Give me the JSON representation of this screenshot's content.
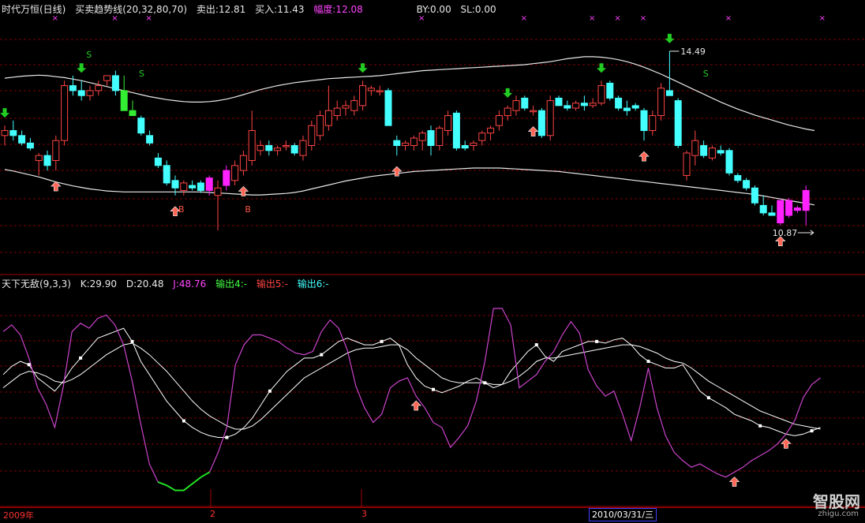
{
  "top_header": {
    "name": "时代万恒(日线)",
    "indicator": "买卖趋势线(20,32,80,70)",
    "sell_label": "卖出:12.81",
    "buy_label": "买入:11.43",
    "range_label": "幅度:12.08",
    "by_label": "BY:0.00",
    "sl_label": "SL:0.00"
  },
  "bottom_header": {
    "name": "天下无敌(9,3,3)",
    "k_label": "K:29.90",
    "d_label": "D:20.48",
    "j_label": "J:48.76",
    "out4": "输出4:-",
    "out5": "输出5:-",
    "out6": "输出6:-"
  },
  "time_axis": {
    "label_2009": "2009年",
    "label_2": "2",
    "label_3": "3",
    "date_box": "2010/03/31/三"
  },
  "watermark": {
    "text": "智股网",
    "sub": "zhigu.com"
  },
  "colors": {
    "up": "#ff4444",
    "down": "#44ffff",
    "highlight": "#ff22ff",
    "signal_buy": "#ff6655",
    "signal_sell": "#22cc22"
  },
  "chart_data": [
    {
      "type": "candlestick",
      "title": "时代万恒(日线)",
      "ylim": [
        10.3,
        15.2
      ],
      "grid": true,
      "price_labels": {
        "high": "14.49",
        "low": "10.87"
      },
      "signal_labels": {
        "S": "S",
        "B": "B"
      },
      "candles": [
        [
          12.8,
          13.0,
          12.6,
          12.9
        ],
        [
          12.9,
          13.1,
          12.7,
          12.8
        ],
        [
          12.8,
          12.9,
          12.6,
          12.65
        ],
        [
          12.65,
          12.75,
          12.5,
          12.55
        ],
        [
          12.3,
          12.45,
          12.0,
          12.4
        ],
        [
          12.4,
          12.5,
          12.1,
          12.2
        ],
        [
          12.3,
          12.8,
          12.1,
          12.7
        ],
        [
          12.7,
          13.9,
          12.6,
          13.8
        ],
        [
          13.8,
          14.0,
          13.6,
          13.7
        ],
        [
          13.7,
          13.9,
          13.5,
          13.6
        ],
        [
          13.6,
          13.8,
          13.5,
          13.7
        ],
        [
          13.7,
          13.9,
          13.6,
          13.8
        ],
        [
          13.9,
          14.0,
          13.8,
          14.0
        ],
        [
          14.0,
          14.1,
          13.6,
          13.7
        ],
        [
          13.7,
          14.0,
          13.6,
          13.3
        ],
        [
          13.3,
          13.5,
          13.2,
          13.2
        ],
        [
          13.15,
          13.2,
          12.8,
          12.85
        ],
        [
          12.8,
          12.9,
          12.6,
          12.65
        ],
        [
          12.35,
          12.45,
          12.15,
          12.2
        ],
        [
          12.2,
          12.3,
          11.8,
          11.85
        ],
        [
          11.9,
          12.0,
          11.6,
          11.75
        ],
        [
          11.7,
          11.9,
          11.6,
          11.85
        ],
        [
          11.8,
          11.9,
          11.7,
          11.75
        ],
        [
          11.85,
          11.9,
          11.65,
          11.7
        ],
        [
          11.7,
          12.0,
          11.6,
          11.95
        ],
        [
          11.6,
          11.9,
          10.9,
          11.75
        ],
        [
          11.8,
          12.2,
          11.7,
          12.1
        ],
        [
          11.9,
          12.3,
          11.8,
          12.2
        ],
        [
          12.1,
          12.5,
          12.0,
          12.4
        ],
        [
          12.3,
          13.3,
          12.2,
          12.9
        ],
        [
          12.5,
          12.7,
          12.4,
          12.6
        ],
        [
          12.6,
          12.7,
          12.4,
          12.5
        ],
        [
          12.5,
          12.6,
          12.4,
          12.55
        ],
        [
          12.6,
          12.7,
          12.5,
          12.6
        ],
        [
          12.6,
          12.65,
          12.4,
          12.45
        ],
        [
          12.4,
          12.8,
          12.3,
          12.7
        ],
        [
          12.6,
          13.1,
          12.5,
          13.0
        ],
        [
          12.8,
          13.3,
          12.7,
          13.2
        ],
        [
          13.0,
          13.8,
          12.9,
          13.3
        ],
        [
          13.2,
          13.5,
          13.1,
          13.35
        ],
        [
          13.35,
          13.5,
          13.2,
          13.4
        ],
        [
          13.3,
          13.6,
          13.2,
          13.5
        ],
        [
          13.4,
          13.9,
          13.3,
          13.8
        ],
        [
          13.7,
          13.8,
          13.6,
          13.75
        ],
        [
          13.7,
          13.8,
          13.6,
          13.7
        ],
        [
          13.7,
          13.75,
          13.0,
          13.0
        ],
        [
          12.7,
          12.8,
          12.4,
          12.6
        ],
        [
          12.6,
          12.7,
          12.5,
          12.65
        ],
        [
          12.6,
          12.8,
          12.5,
          12.75
        ],
        [
          12.7,
          12.9,
          12.5,
          12.85
        ],
        [
          12.9,
          13.0,
          12.4,
          12.6
        ],
        [
          12.6,
          13.0,
          12.5,
          12.95
        ],
        [
          12.9,
          13.3,
          12.8,
          13.2
        ],
        [
          13.25,
          13.3,
          12.5,
          12.55
        ],
        [
          12.6,
          12.7,
          12.5,
          12.55
        ],
        [
          12.6,
          12.7,
          12.5,
          12.65
        ],
        [
          12.7,
          12.9,
          12.6,
          12.85
        ],
        [
          12.85,
          13.0,
          12.7,
          12.95
        ],
        [
          13.0,
          13.3,
          12.9,
          13.2
        ],
        [
          13.2,
          13.4,
          13.1,
          13.35
        ],
        [
          13.3,
          13.6,
          13.2,
          13.5
        ],
        [
          13.55,
          13.6,
          13.3,
          13.35
        ],
        [
          13.3,
          13.4,
          13.2,
          13.3
        ],
        [
          13.3,
          13.35,
          12.75,
          12.8
        ],
        [
          12.8,
          13.6,
          12.7,
          13.5
        ],
        [
          13.55,
          13.6,
          13.4,
          13.4
        ],
        [
          13.4,
          13.5,
          13.3,
          13.35
        ],
        [
          13.35,
          13.5,
          13.3,
          13.45
        ],
        [
          13.45,
          13.6,
          13.3,
          13.4
        ],
        [
          13.4,
          13.55,
          13.35,
          13.45
        ],
        [
          13.45,
          13.9,
          13.4,
          13.8
        ],
        [
          13.85,
          13.9,
          13.5,
          13.55
        ],
        [
          13.55,
          13.6,
          13.3,
          13.35
        ],
        [
          13.35,
          13.5,
          13.2,
          13.3
        ],
        [
          13.4,
          13.45,
          13.3,
          13.35
        ],
        [
          13.3,
          13.35,
          12.7,
          12.9
        ],
        [
          12.9,
          13.3,
          12.8,
          13.2
        ],
        [
          13.2,
          13.85,
          13.1,
          13.75
        ],
        [
          13.7,
          14.49,
          13.6,
          13.6
        ],
        [
          13.5,
          13.55,
          12.55,
          12.6
        ],
        [
          12.0,
          12.5,
          11.9,
          12.45
        ],
        [
          12.4,
          12.9,
          12.2,
          12.7
        ],
        [
          12.6,
          12.7,
          12.35,
          12.4
        ],
        [
          12.35,
          12.6,
          12.3,
          12.55
        ],
        [
          12.5,
          12.6,
          12.4,
          12.45
        ],
        [
          12.5,
          12.55,
          12.0,
          12.05
        ],
        [
          12.0,
          12.05,
          11.85,
          11.9
        ],
        [
          11.9,
          11.95,
          11.7,
          11.75
        ],
        [
          11.75,
          11.8,
          11.4,
          11.45
        ],
        [
          11.4,
          11.6,
          11.2,
          11.25
        ],
        [
          11.25,
          11.4,
          11.2,
          11.2
        ],
        [
          11.5,
          11.5,
          11.0,
          11.05
        ],
        [
          11.5,
          11.55,
          11.15,
          11.2
        ],
        [
          11.35,
          11.4,
          11.25,
          11.3
        ],
        [
          11.3,
          11.8,
          11.0,
          11.7
        ]
      ],
      "upper_band": [
        13.95,
        13.97,
        13.99,
        14.0,
        14.01,
        14.0,
        13.98,
        13.96,
        13.93,
        13.9,
        13.86,
        13.82,
        13.78,
        13.74,
        13.7,
        13.66,
        13.62,
        13.58,
        13.55,
        13.52,
        13.5,
        13.48,
        13.47,
        13.47,
        13.48,
        13.5,
        13.53,
        13.57,
        13.62,
        13.67,
        13.72,
        13.76,
        13.8,
        13.83,
        13.86,
        13.88,
        13.9,
        13.92,
        13.94,
        13.95,
        13.96,
        13.97,
        13.98,
        13.99,
        14.0,
        14.02,
        14.04,
        14.06,
        14.08,
        14.1,
        14.11,
        14.12,
        14.13,
        14.14,
        14.15,
        14.16,
        14.17,
        14.18,
        14.19,
        14.2,
        14.21,
        14.22,
        14.24,
        14.26,
        14.28,
        14.31,
        14.34,
        14.36,
        14.38,
        14.38,
        14.37,
        14.35,
        14.32,
        14.28,
        14.23,
        14.17,
        14.1,
        14.03,
        13.95,
        13.87,
        13.79,
        13.71,
        13.63,
        13.55,
        13.47,
        13.4,
        13.33,
        13.27,
        13.21,
        13.16,
        13.11,
        13.06,
        13.01,
        12.97,
        12.93,
        12.9
      ],
      "lower_band": [
        12.12,
        12.09,
        12.05,
        12.01,
        11.97,
        11.92,
        11.87,
        11.83,
        11.79,
        11.76,
        11.73,
        11.71,
        11.69,
        11.68,
        11.67,
        11.67,
        11.67,
        11.67,
        11.67,
        11.67,
        11.67,
        11.67,
        11.67,
        11.67,
        11.66,
        11.65,
        11.64,
        11.63,
        11.62,
        11.61,
        11.61,
        11.62,
        11.63,
        11.64,
        11.66,
        11.69,
        11.73,
        11.77,
        11.81,
        11.85,
        11.89,
        11.92,
        11.95,
        11.98,
        12.0,
        12.02,
        12.04,
        12.06,
        12.08,
        12.09,
        12.1,
        12.11,
        12.12,
        12.13,
        12.14,
        12.15,
        12.15,
        12.15,
        12.15,
        12.14,
        12.13,
        12.12,
        12.11,
        12.1,
        12.09,
        12.08,
        12.06,
        12.04,
        12.02,
        12.0,
        11.98,
        11.96,
        11.94,
        11.92,
        11.9,
        11.88,
        11.86,
        11.84,
        11.82,
        11.8,
        11.78,
        11.76,
        11.74,
        11.72,
        11.7,
        11.68,
        11.66,
        11.64,
        11.62,
        11.59,
        11.56,
        11.53,
        11.5,
        11.47,
        11.44,
        11.41
      ],
      "buy_signals": [
        6,
        20,
        28,
        46,
        62,
        75,
        91
      ],
      "sell_signals": [
        0,
        9,
        42,
        59,
        70,
        78
      ]
    },
    {
      "type": "line",
      "title": "天下无敌(9,3,3)",
      "ylim": [
        -12,
        112
      ],
      "series": [
        {
          "name": "K",
          "color": "#ffffff",
          "values": [
            62,
            67,
            70,
            68,
            60,
            56,
            52,
            58,
            66,
            72,
            78,
            84,
            86,
            88,
            90,
            82,
            70,
            62,
            54,
            46,
            40,
            34,
            30,
            27,
            25,
            24,
            24,
            26,
            30,
            36,
            44,
            52,
            58,
            64,
            68,
            72,
            72,
            74,
            78,
            82,
            84,
            82,
            80,
            80,
            82,
            84,
            80,
            68,
            60,
            55,
            53,
            51,
            53,
            55,
            58,
            60,
            57,
            54,
            56,
            64,
            70,
            76,
            80,
            73,
            70,
            76,
            78,
            80,
            82,
            82,
            81,
            83,
            84,
            80,
            74,
            70,
            68,
            66,
            66,
            68,
            60,
            52,
            48,
            45,
            42,
            38,
            36,
            34,
            31,
            30,
            28,
            26,
            25,
            26,
            28,
            30
          ]
        },
        {
          "name": "D",
          "color": "#ffffff",
          "values": [
            54,
            58,
            62,
            64,
            63,
            61,
            58,
            57,
            59,
            62,
            66,
            70,
            74,
            77,
            80,
            81,
            78,
            74,
            69,
            64,
            58,
            52,
            46,
            41,
            37,
            34,
            31,
            29,
            29,
            31,
            35,
            40,
            45,
            50,
            55,
            60,
            63,
            66,
            69,
            72,
            75,
            77,
            78,
            78,
            79,
            80,
            80,
            77,
            72,
            68,
            64,
            60,
            58,
            57,
            57,
            57,
            57,
            56,
            56,
            58,
            61,
            65,
            70,
            72,
            72,
            73,
            74,
            75,
            76,
            77,
            78,
            79,
            80,
            80,
            79,
            77,
            75,
            72,
            70,
            69,
            66,
            62,
            58,
            55,
            52,
            49,
            46,
            43,
            40,
            38,
            36,
            34,
            32,
            31,
            30,
            29
          ]
        },
        {
          "name": "J",
          "color": "#cc44cc",
          "values": [
            88,
            92,
            86,
            72,
            54,
            44,
            30,
            55,
            88,
            93,
            90,
            96,
            98,
            92,
            80,
            58,
            32,
            8,
            -3,
            -5,
            -8,
            -8,
            -4,
            0,
            3,
            15,
            30,
            68,
            80,
            86,
            86,
            84,
            82,
            78,
            75,
            74,
            76,
            88,
            95,
            90,
            77,
            55,
            42,
            33,
            38,
            54,
            58,
            60,
            49,
            42,
            33,
            30,
            18,
            24,
            31,
            46,
            70,
            102,
            102,
            92,
            54,
            58,
            62,
            70,
            76,
            86,
            94,
            87,
            65,
            55,
            49,
            52,
            38,
            22,
            42,
            66,
            42,
            25,
            15,
            10,
            6,
            8,
            5,
            2,
            0,
            3,
            6,
            10,
            13,
            16,
            20,
            26,
            34,
            48,
            56,
            60
          ]
        }
      ],
      "green_span": [
        18,
        24
      ],
      "dot_indices": [
        3,
        9,
        15,
        21,
        26,
        31,
        37,
        44,
        50,
        56,
        62,
        69,
        75,
        82,
        88,
        94
      ],
      "buy_signals": [
        48,
        85,
        91
      ]
    }
  ]
}
